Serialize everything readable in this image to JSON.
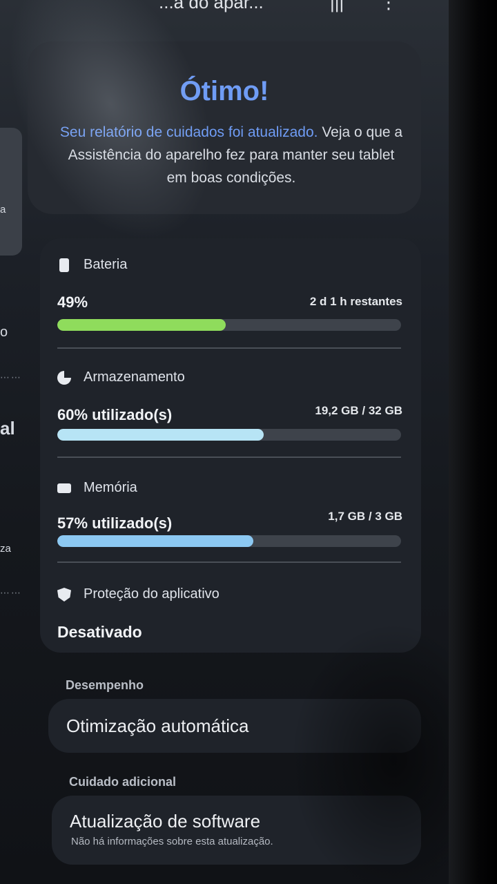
{
  "topbar": {
    "title": "...a do apar...",
    "lines_icon": "|||",
    "more_icon": "⋮"
  },
  "sidebar": {
    "fragments": [
      "a",
      "o",
      "al",
      "za"
    ],
    "dots": "⋯⋯"
  },
  "status": {
    "title": "Ótimo!",
    "desc_link": "Seu relatório de cuidados foi atualizado.",
    "desc_rest": " Veja o que a Assistência do aparelho fez para manter seu tablet em boas condições."
  },
  "battery": {
    "label": "Bateria",
    "percent": "49%",
    "remaining": "2 d 1 h restantes",
    "level": 0.49,
    "color": "#8fdc5c"
  },
  "storage": {
    "label": "Armazenamento",
    "used": "60% utilizado(s)",
    "capacity": "19,2 GB / 32 GB",
    "level": 0.6,
    "color": "#b7e4f5"
  },
  "memory": {
    "label": "Memória",
    "used": "57% utilizado(s)",
    "capacity": "1,7 GB / 3 GB",
    "level": 0.57,
    "color": "#8cc8f2"
  },
  "app_protection": {
    "label": "Proteção do aplicativo",
    "status": "Desativado"
  },
  "performance": {
    "category": "Desempenho",
    "item": "Otimização automática"
  },
  "additional": {
    "category": "Cuidado adicional",
    "item": "Atualização de software",
    "item_sub": "Não há informações sobre esta atualização."
  }
}
